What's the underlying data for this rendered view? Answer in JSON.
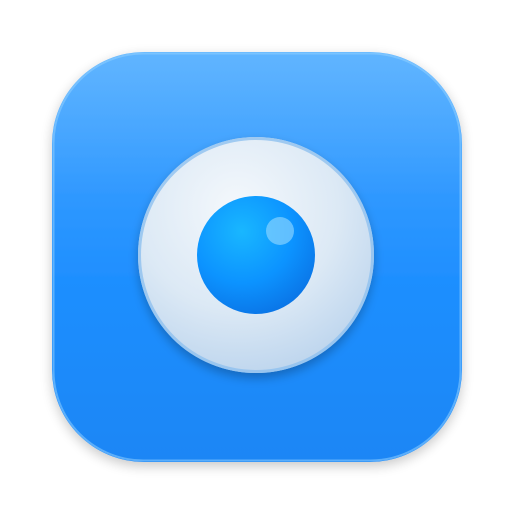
{
  "icon": {
    "name": "eye-camera-app-icon",
    "colors": {
      "tile_top": "#4ba8ff",
      "tile_mid": "#1f8fff",
      "tile_bottom": "#1a86f5",
      "tile_edge_light": "#8fd0ff",
      "ring_light": "#f4f8fc",
      "ring_mid": "#dce9f5",
      "ring_dark": "#b7d1ec",
      "ring_rim": "#8fc0ef",
      "pupil_light": "#19b7ff",
      "pupil_mid": "#0c93ff",
      "pupil_dark": "#0a6fe2",
      "highlight": "#8fd6ff"
    }
  }
}
